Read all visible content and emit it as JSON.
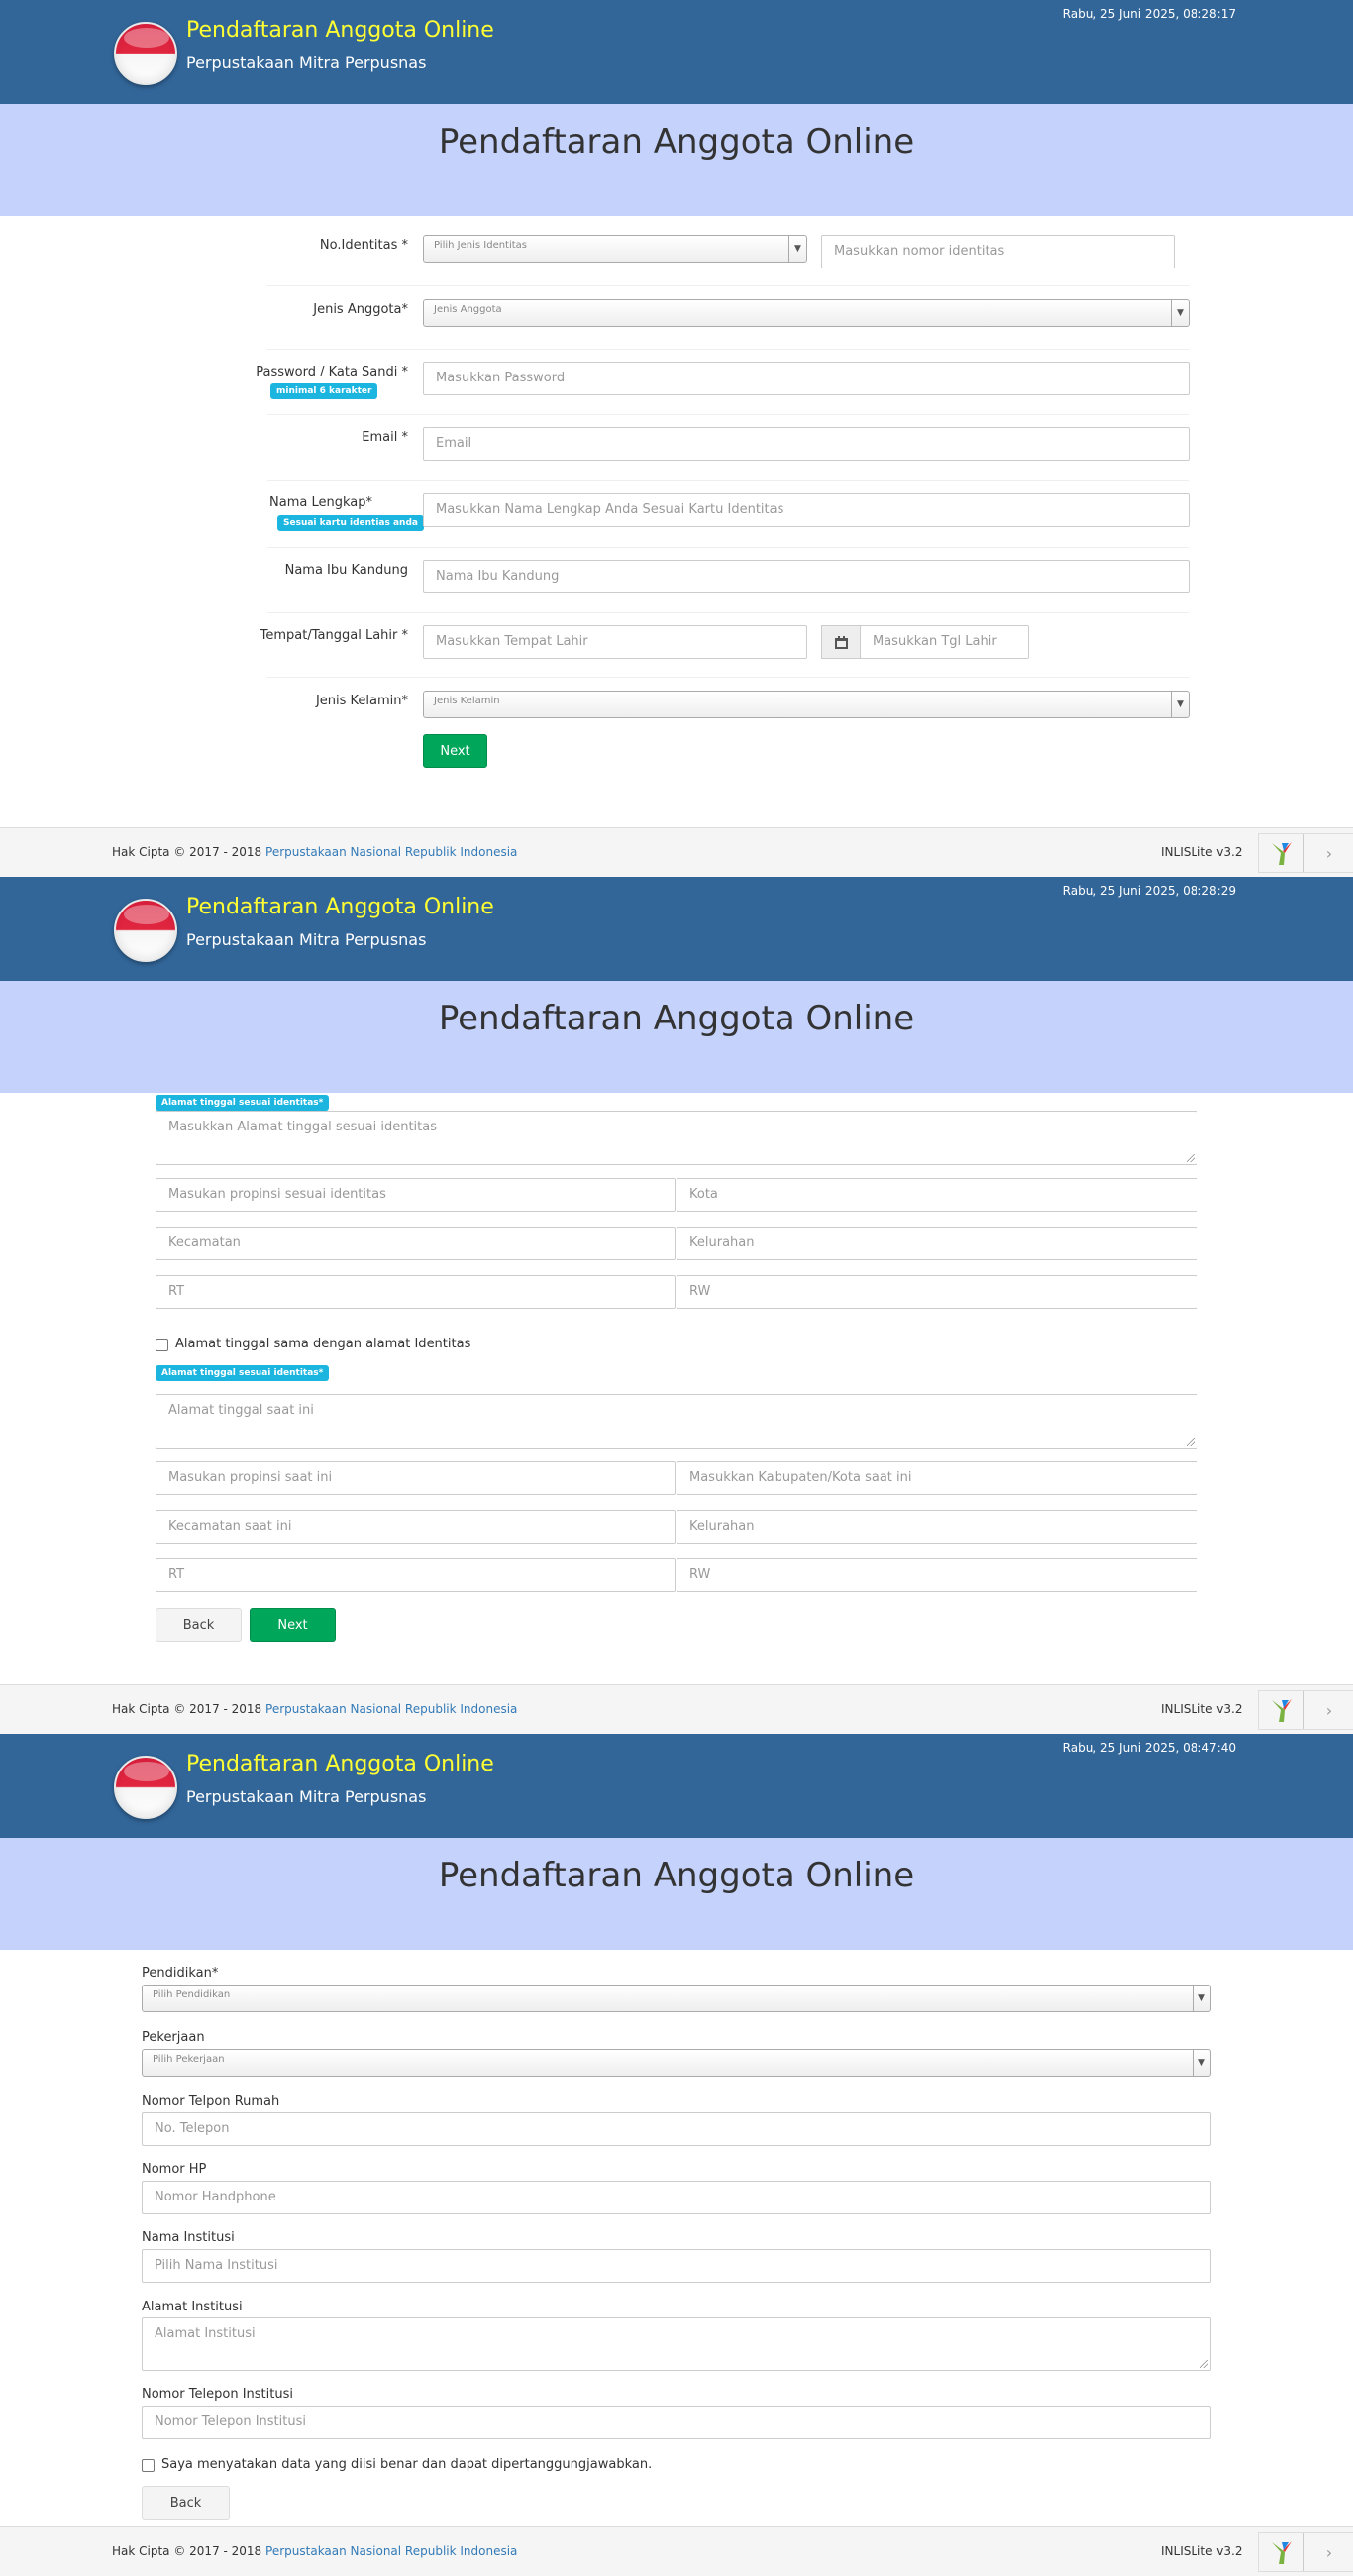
{
  "app": {
    "title": "Pendaftaran Anggota Online",
    "subtitle": "Perpustakaan Mitra Perpusnas",
    "page_heading": "Pendaftaran Anggota Online"
  },
  "screens": [
    {
      "datetime": "Rabu, 25 Juni 2025, 08:28:17"
    },
    {
      "datetime": "Rabu, 25 Juni 2025, 08:28:29"
    },
    {
      "datetime": "Rabu, 25 Juni 2025, 08:47:40"
    }
  ],
  "footer": {
    "copyright": "Hak Cipta © 2017 - 2018",
    "link": "Perpustakaan Nasional Republik Indonesia",
    "version": "INLISLite v3.2"
  },
  "step1": {
    "no_identitas_label": "No.Identitas *",
    "jenis_identitas_placeholder": "Pilih Jenis Identitas",
    "nomor_identitas_placeholder": "Masukkan nomor identitas",
    "jenis_anggota_label": "Jenis Anggota*",
    "jenis_anggota_placeholder": "Jenis Anggota",
    "password_label": "Password / Kata Sandi *",
    "password_badge": "minimal 6 karakter",
    "password_placeholder": "Masukkan Password",
    "email_label": "Email *",
    "email_placeholder": "Email",
    "nama_label": "Nama Lengkap*",
    "nama_badge": "Sesuai kartu identias anda",
    "nama_placeholder": "Masukkan Nama Lengkap Anda Sesuai Kartu Identitas",
    "ibu_label": "Nama Ibu Kandung",
    "ibu_placeholder": "Nama Ibu Kandung",
    "ttl_label": "Tempat/Tanggal Lahir *",
    "tempat_placeholder": "Masukkan Tempat Lahir",
    "tgl_placeholder": "Masukkan Tgl Lahir",
    "kelamin_label": "Jenis Kelamin*",
    "kelamin_placeholder": "Jenis Kelamin",
    "next": "Next"
  },
  "step2": {
    "badge1": "Alamat tinggal sesuai identitas*",
    "alamat_placeholder": "Masukkan Alamat tinggal sesuai identitas",
    "propinsi_placeholder": "Masukan propinsi sesuai identitas",
    "kota_placeholder": "Kota",
    "kecamatan_placeholder": "Kecamatan",
    "kelurahan_placeholder": "Kelurahan",
    "rt_placeholder": "RT",
    "rw_placeholder": "RW",
    "same_address_label": "Alamat tinggal sama dengan alamat Identitas",
    "badge2": "Alamat tinggal sesuai identitas*",
    "alamat_now_placeholder": "Alamat tinggal saat ini",
    "propinsi_now_placeholder": "Masukan propinsi saat ini",
    "kota_now_placeholder": "Masukkan Kabupaten/Kota saat ini",
    "kecamatan_now_placeholder": "Kecamatan saat ini",
    "kelurahan_now_placeholder": "Kelurahan",
    "rt_now_placeholder": "RT",
    "rw_now_placeholder": "RW",
    "back": "Back",
    "next": "Next"
  },
  "step3": {
    "pendidikan_label": "Pendidikan*",
    "pendidikan_placeholder": "Pilih Pendidikan",
    "pekerjaan_label": "Pekerjaan",
    "pekerjaan_placeholder": "Pilih Pekerjaan",
    "telp_label": "Nomor Telpon Rumah",
    "telp_placeholder": "No. Telepon",
    "hp_label": "Nomor HP",
    "hp_placeholder": "Nomor Handphone",
    "institusi_label": "Nama Institusi",
    "institusi_placeholder": "Pilih Nama Institusi",
    "alamat_inst_label": "Alamat Institusi",
    "alamat_inst_placeholder": "Alamat Institusi",
    "telp_inst_label": "Nomor Telepon Institusi",
    "telp_inst_placeholder": "Nomor Telepon Institusi",
    "declaration": "Saya menyatakan data yang diisi benar dan dapat dipertanggungjawabkan.",
    "back": "Back"
  },
  "colors": {
    "header": "#326699",
    "band": "#c5d3fc",
    "title": "#ffff33",
    "accent_green": "#00a65a",
    "badge": "#1cb5e0",
    "link": "#337ab7"
  }
}
